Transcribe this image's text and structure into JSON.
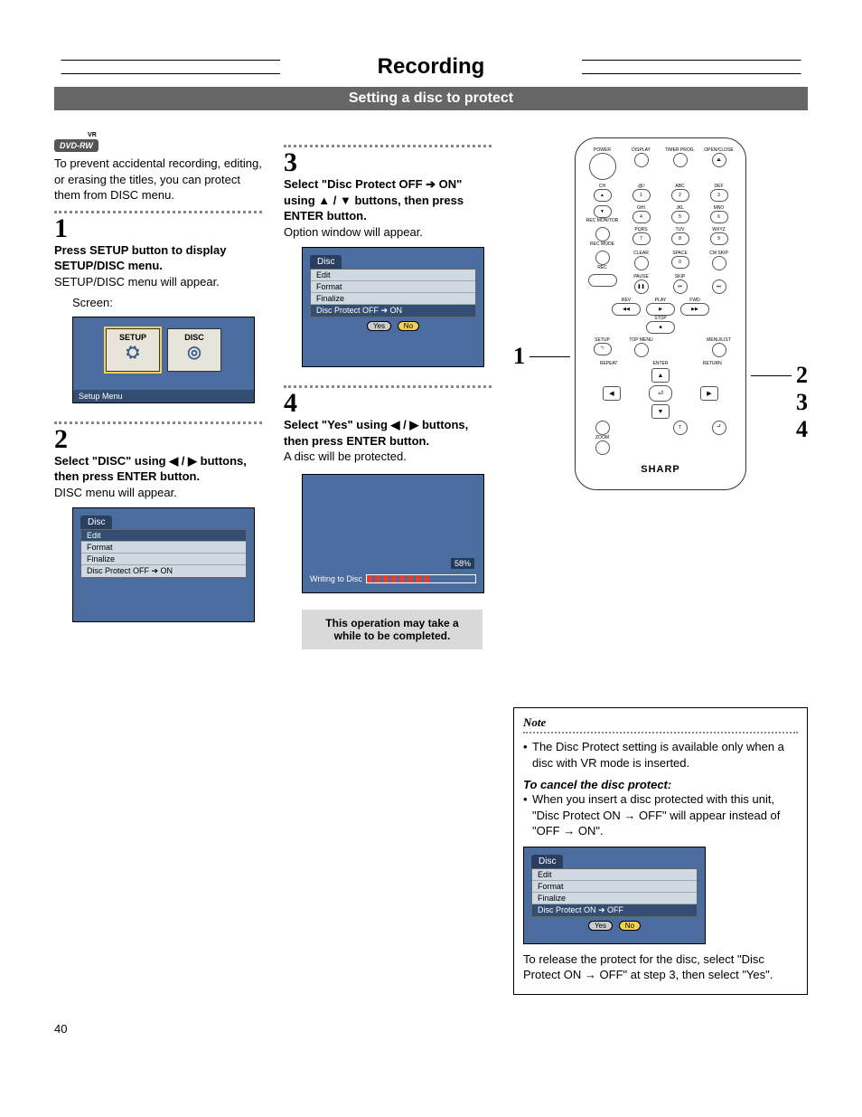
{
  "page_number": "40",
  "header": {
    "title": "Recording",
    "subtitle": "Setting a disc to protect"
  },
  "badge": "DVD-RW",
  "badge_sup": "VR",
  "intro": "To prevent accidental recording, editing, or erasing the titles, you can protect them from DISC menu.",
  "step1": {
    "num": "1",
    "bold": "Press SETUP button to display SETUP/DISC menu.",
    "text": "SETUP/DISC menu will appear.",
    "screen_label": "Screen:",
    "tile1": "SETUP",
    "tile2": "DISC",
    "footer": "Setup Menu"
  },
  "step2": {
    "num": "2",
    "bold": "Select \"DISC\" using ◀ / ▶ buttons, then press ENTER button.",
    "text": "DISC menu will appear.",
    "osd_title": "Disc",
    "rows": [
      "Edit",
      "Format",
      "Finalize",
      "Disc Protect OFF ➔ ON"
    ]
  },
  "step3": {
    "num": "3",
    "bold": "Select \"Disc Protect OFF ➔ ON\" using ▲ / ▼ buttons, then press ENTER button.",
    "text": "Option window will appear.",
    "osd_title": "Disc",
    "rows": [
      "Edit",
      "Format",
      "Finalize",
      "Disc Protect OFF ➔ ON"
    ],
    "yes": "Yes",
    "no": "No"
  },
  "step4": {
    "num": "4",
    "bold": "Select \"Yes\" using ◀ / ▶ buttons, then press ENTER button.",
    "text": "A disc will be protected.",
    "pct": "58%",
    "writing": "Writing to Disc",
    "callout": "This operation may take a while to be completed."
  },
  "remote": {
    "labels": {
      "power": "POWER",
      "display": "DISPLAY",
      "timer": "TIMER PROG.",
      "open": "OPEN/CLOSE",
      "ch": "CH",
      "at": ".@/:",
      "abc": "ABC",
      "def": "DEF",
      "rec_monitor": "REC MONITOR",
      "ghi": "GHI",
      "jkl": "JKL",
      "mno": "MNO",
      "rec_mode": "REC MODE",
      "pqrs": "PQRS",
      "tuv": "TUV",
      "wxyz": "WXYZ",
      "rec": "REC",
      "clear": "CLEAR",
      "space": "SPACE",
      "cmskip": "CM SKIP",
      "pause": "PAUSE",
      "skip": "SKIP",
      "play": "PLAY",
      "rev": "REV",
      "fwd": "FWD",
      "stop": "STOP",
      "setup": "SETUP",
      "topmenu": "TOP MENU",
      "menulist": "MENU/LIST",
      "repeat": "REPEAT",
      "enter": "ENTER",
      "return": "RETURN",
      "zoom": "ZOOM",
      "brand": "SHARP"
    },
    "nums": {
      "1": "1",
      "2": "2",
      "3": "3",
      "4": "4",
      "5": "5",
      "6": "6",
      "7": "7",
      "8": "8",
      "9": "9",
      "0": "0"
    },
    "callouts": {
      "left": "1",
      "r1": "2",
      "r2": "3",
      "r3": "4"
    }
  },
  "note": {
    "title": "Note",
    "li1": "The Disc Protect setting is available only when a disc with VR mode is inserted.",
    "cancel_head": "To cancel the disc protect:",
    "li2": "When you insert a disc protected with this unit, \"Disc Protect ON → OFF\" will appear instead of \"OFF → ON\".",
    "osd_title": "Disc",
    "rows": [
      "Edit",
      "Format",
      "Finalize",
      "Disc Protect ON  ➔ OFF"
    ],
    "yes": "Yes",
    "no": "No",
    "tail": "To release the protect for the disc, select \"Disc Protect ON → OFF\" at step 3, then select \"Yes\"."
  }
}
